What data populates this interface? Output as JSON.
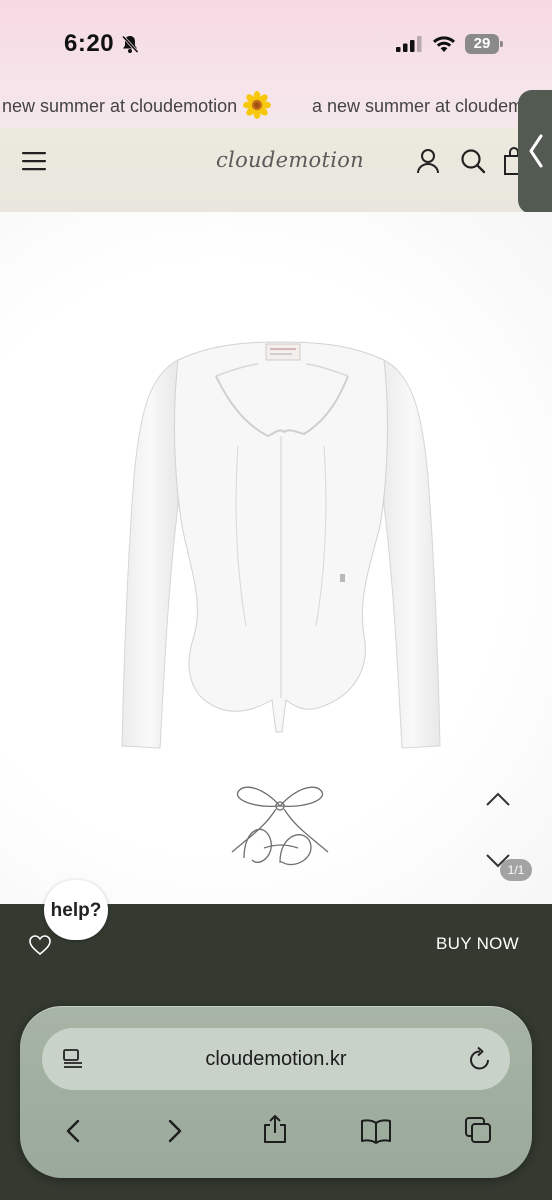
{
  "status_bar": {
    "time": "6:20",
    "battery_level": "29",
    "icons": [
      "bell-off-icon",
      "cellular-signal-icon",
      "wifi-icon",
      "battery-icon"
    ]
  },
  "announcement": {
    "text_left": "new summer at cloudemotion",
    "text_right": "a new summer at cloudem",
    "emoji": "flower-icon"
  },
  "header": {
    "logo": "cloudemotion",
    "icons": [
      "menu-icon",
      "user-icon",
      "search-icon",
      "bag-icon",
      "chevron-left-icon"
    ]
  },
  "product": {
    "image": "white-shirt-image",
    "brand_mark": "bow-logo-sketch",
    "slide_counter": "1/1",
    "icons": [
      "chevron-up-icon",
      "chevron-down-icon"
    ]
  },
  "actions": {
    "help_label": "help?",
    "buy_now_label": "BUY NOW",
    "wishlist_icon": "heart-icon"
  },
  "browser": {
    "url": "cloudemotion.kr",
    "icons": [
      "page-menu-icon",
      "reload-icon",
      "back-icon",
      "forward-icon",
      "share-icon",
      "bookmarks-icon",
      "tabs-icon"
    ]
  },
  "colors": {
    "announce_bg": "#f6e3ea",
    "header_bg": "#ebe8de",
    "dark_bg": "#343a30",
    "browser_bg": "#a0ae9f"
  }
}
